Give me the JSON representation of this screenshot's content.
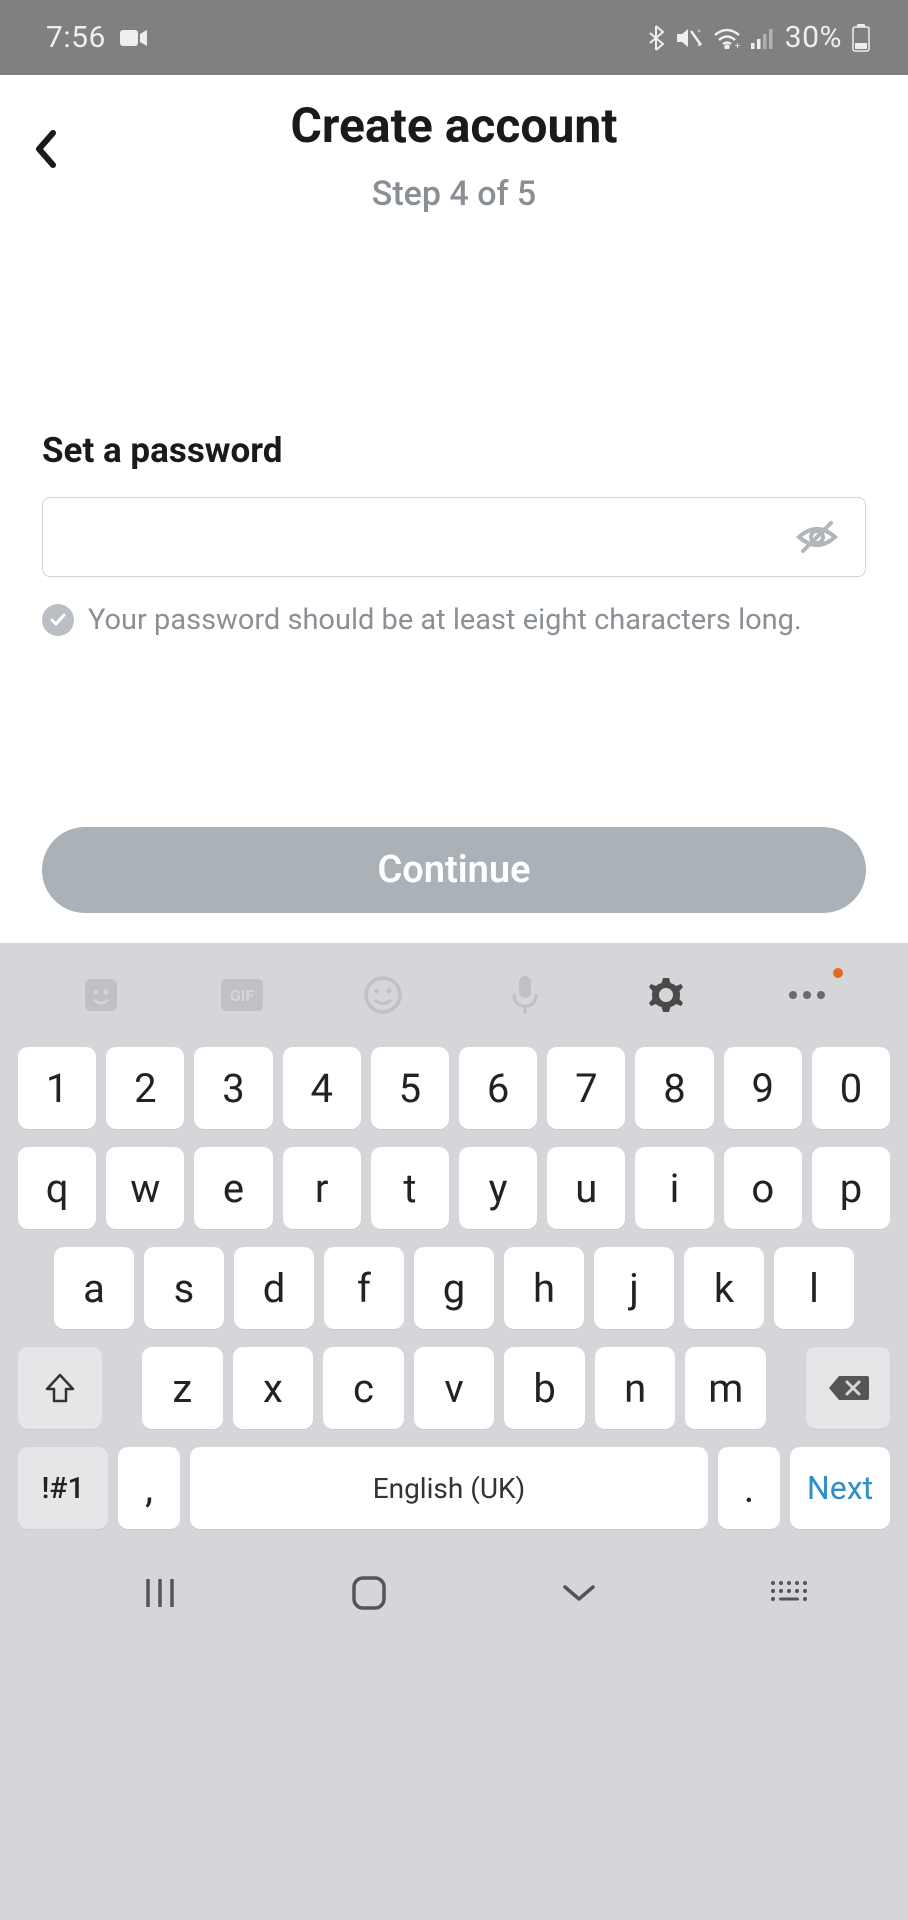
{
  "status_bar": {
    "time": "7:56",
    "battery_pct": "30%"
  },
  "header": {
    "title": "Create account",
    "step": "Step 4 of 5"
  },
  "form": {
    "label": "Set a password",
    "input_value": "",
    "hint": "Your password should be at least eight characters long."
  },
  "actions": {
    "continue": "Continue"
  },
  "keyboard": {
    "row1": [
      "1",
      "2",
      "3",
      "4",
      "5",
      "6",
      "7",
      "8",
      "9",
      "0"
    ],
    "row2": [
      "q",
      "w",
      "e",
      "r",
      "t",
      "y",
      "u",
      "i",
      "o",
      "p"
    ],
    "row3": [
      "a",
      "s",
      "d",
      "f",
      "g",
      "h",
      "j",
      "k",
      "l"
    ],
    "row4": [
      "z",
      "x",
      "c",
      "v",
      "b",
      "n",
      "m"
    ],
    "sym_key": "!#1",
    "comma_key": ",",
    "space_key": "English (UK)",
    "dot_key": ".",
    "next_key": "Next"
  }
}
